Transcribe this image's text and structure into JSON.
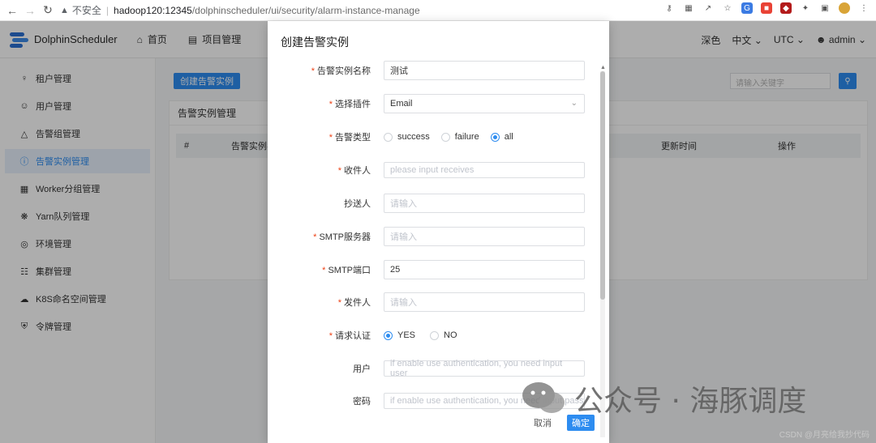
{
  "browser": {
    "insecure_label": "不安全",
    "url_host": "hadoop120:12345",
    "url_path": "/dolphinscheduler/ui/security/alarm-instance-manage"
  },
  "header": {
    "logo_text": "DolphinScheduler",
    "nav": [
      {
        "label": "首页",
        "icon": "home-icon"
      },
      {
        "label": "项目管理",
        "icon": "project-icon"
      }
    ],
    "theme": "深色",
    "language": "中文",
    "timezone": "UTC",
    "user": "admin"
  },
  "sidebar": {
    "items": [
      {
        "label": "租户管理",
        "icon": "tenant-icon",
        "active": false
      },
      {
        "label": "用户管理",
        "icon": "user-icon",
        "active": false
      },
      {
        "label": "告警组管理",
        "icon": "warning-icon",
        "active": false
      },
      {
        "label": "告警实例管理",
        "icon": "info-icon",
        "active": true
      },
      {
        "label": "Worker分组管理",
        "icon": "worker-icon",
        "active": false
      },
      {
        "label": "Yarn队列管理",
        "icon": "yarn-icon",
        "active": false
      },
      {
        "label": "环境管理",
        "icon": "environment-icon",
        "active": false
      },
      {
        "label": "集群管理",
        "icon": "cluster-icon",
        "active": false
      },
      {
        "label": "K8S命名空间管理",
        "icon": "cloud-icon",
        "active": false
      },
      {
        "label": "令牌管理",
        "icon": "shield-icon",
        "active": false
      }
    ]
  },
  "main": {
    "create_button": "创建告警实例",
    "search_placeholder": "请输入关键字",
    "card_title": "告警实例管理",
    "table_headers": [
      "#",
      "告警实例名",
      "更新时间",
      "操作"
    ]
  },
  "modal": {
    "title": "创建告警实例",
    "fields": {
      "name": {
        "label": "告警实例名称",
        "value": "测试"
      },
      "plugin": {
        "label": "选择插件",
        "value": "Email"
      },
      "alert_type": {
        "label": "告警类型",
        "options": [
          "success",
          "failure",
          "all"
        ],
        "selected": "all"
      },
      "receivers": {
        "label": "收件人",
        "placeholder": "please input receives"
      },
      "cc": {
        "label": "抄送人",
        "placeholder": "请输入"
      },
      "smtp_server": {
        "label": "SMTP服务器",
        "placeholder": "请输入"
      },
      "smtp_port": {
        "label": "SMTP端口",
        "value": "25"
      },
      "sender": {
        "label": "发件人",
        "placeholder": "请输入"
      },
      "auth": {
        "label": "请求认证",
        "options": [
          "YES",
          "NO"
        ],
        "selected": "YES"
      },
      "user": {
        "label": "用户",
        "placeholder": "if enable use authentication, you need input user"
      },
      "password": {
        "label": "密码",
        "placeholder": "if enable use authentication, you need input passw"
      }
    },
    "cancel": "取消",
    "confirm": "确定"
  },
  "watermarks": {
    "wechat": "公众号 · 海豚调度",
    "csdn": "CSDN @月亮给我抄代码"
  }
}
